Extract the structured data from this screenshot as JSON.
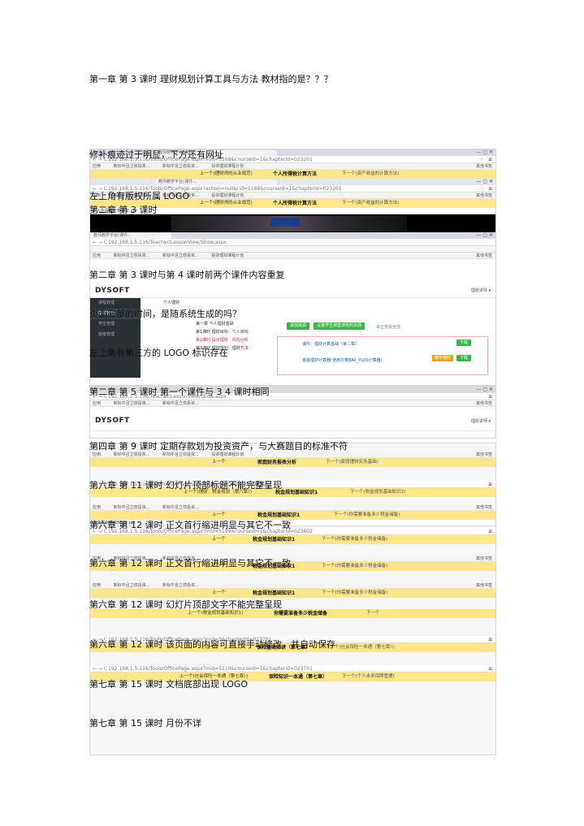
{
  "intro": "第一章 第 3 课时  理财规划计算工具与方法  教材指的是？？？",
  "captions": [
    "修补痕迹过于明显，下方还有网址",
    "左上角有版权所属 LOGO",
    "第二章 第 3 课时",
    "第二章 第 3 课时与第 4 课时前两个课件内容重复",
    "页面底部的时间，是随系统生成的吗？",
    "左上角有第三方的 LOGO 标识存在",
    "第二章 第 5 课时 第一个课件与 3 4 课时相同",
    "第四章 第 9 课时  定期存款划为投资资产，与大赛题目的标准不符",
    "第六章 第 11 课时  幻灯片顶部标题不能完整呈现",
    "第六章 第 12 课时  正文首行缩进明显与其它不一致",
    "第六章 第 12 课时  正文首行缩进明显与其它不一致",
    "第六章 第 12 课时  幻灯片顶部文字不能完整呈现",
    "第六章 第 12 课时  该页面的内容可直接手动修改，并自动保存",
    "第七章 第 15 课时 文档底部出现 LOGO",
    "第七章 第 15 课时  月份不详"
  ],
  "browser": {
    "url1": "192.168.1.5:116/Tools/OfficePage.aspx?mid=5168&courseId=1&chapterId=023201",
    "url2": "192.168.1.5:116/Tools/OfficePage.aspx?action=null&rid=5168&courseId=1&chapterId=023201",
    "url3": "192.168.1.5:116/Teacher/LessonView/Show.aspx",
    "url4": "192.168.1.5:116/Tools/OfficePage.aspx?mid=5&chapterId=023601",
    "url5": "192.168.1.5:116/Tools/OfficePage.aspx?mid=5199&courseId=1&chapterId=023602",
    "url6": "192.168.1.5:116/Tools/OfficePage.aspx?mid=5&chapterId=023701",
    "url7": "192.168.1.5:116/Tools/OfficePage.aspx?mid=5210&courseId=1&chapterId=023701",
    "bookmarks": [
      "应用",
      "新标中且立债投资...",
      "新标中且立债投资...",
      "投资理财课程计划",
      "公司增值认证...",
      "其他书签"
    ],
    "tab_label": "教师教学平台(课件...",
    "ppt_name": "个人所得税计算方法.ppt",
    "ppt_name2": "税金规划基础知识1.ppt"
  },
  "strips": {
    "prev": "上一个",
    "next": "下一个",
    "s1_prev": "上一个(理财师的从业规范)",
    "s1_title": "个人所得税计算方法",
    "s1_next": "下一个(资产收益的计算方法)",
    "s2_prev": "上一个(理财师的从业规范)",
    "s2_title": "个人所得税计算方法",
    "s2_next": "下一个(资产收益的计算方法)",
    "s3_title": "家庭财务报表分析",
    "s3_next": "下一个(家庭理财实务基础)",
    "s4_prev": "上一个(理财：税金规划（第六章）)",
    "s4_title": "税金规划基础知识1",
    "s4_next": "下一个(税金规划基础知识2)",
    "s5_title": "税金规划基础知识1",
    "s5_next": "下一个(你需要准备多少税金储备)",
    "s6_title": "税金规划基础知识1",
    "s6_next": "下一个(你需要准备多少税金储备)",
    "s7_title": "税金规划基础知识1",
    "s7_next": "下一个(你需要准备多少税金储备)",
    "s8_title": "税金规划基础知识1",
    "s8_next": "下一个(你需要准备多少税金储备)",
    "s9_prev": "上一个(税金规划基础知识1)",
    "s9_title": "你需要准备多少税金储备",
    "s10_title": "保险基础知识（第七章）",
    "s10_next": "下一个(社会保险一本通（第七章）)",
    "s11_prev": "上一个(社会保险一本通（第七章）)",
    "s11_title": "保险知识一本通（第七章）",
    "s11_next": "下一个(个人未来保障管理)"
  },
  "lms": {
    "logo": "DYSOFT",
    "user": "理财讲师 ▾",
    "course": "个人理财",
    "menu": [
      "课程管理",
      "备课管理",
      "学生管理",
      "班级管理"
    ],
    "lessons": [
      "第一章 个人理财基础",
      "第1课时 理财目标：个人目标",
      "第2课时 投资理财：风险分析",
      "第3课时 理财规划：理财方法"
    ],
    "btn_add": "添加资源",
    "btn_set": "设置学生课堂浏览的资源",
    "hint": "单击查看全部",
    "res1": "课件：理财计算基础（第二章）",
    "res2": "金融理财计算器(使用华泰BAII_PLUS计算器)",
    "download": "下载",
    "tag": "教学课件"
  }
}
